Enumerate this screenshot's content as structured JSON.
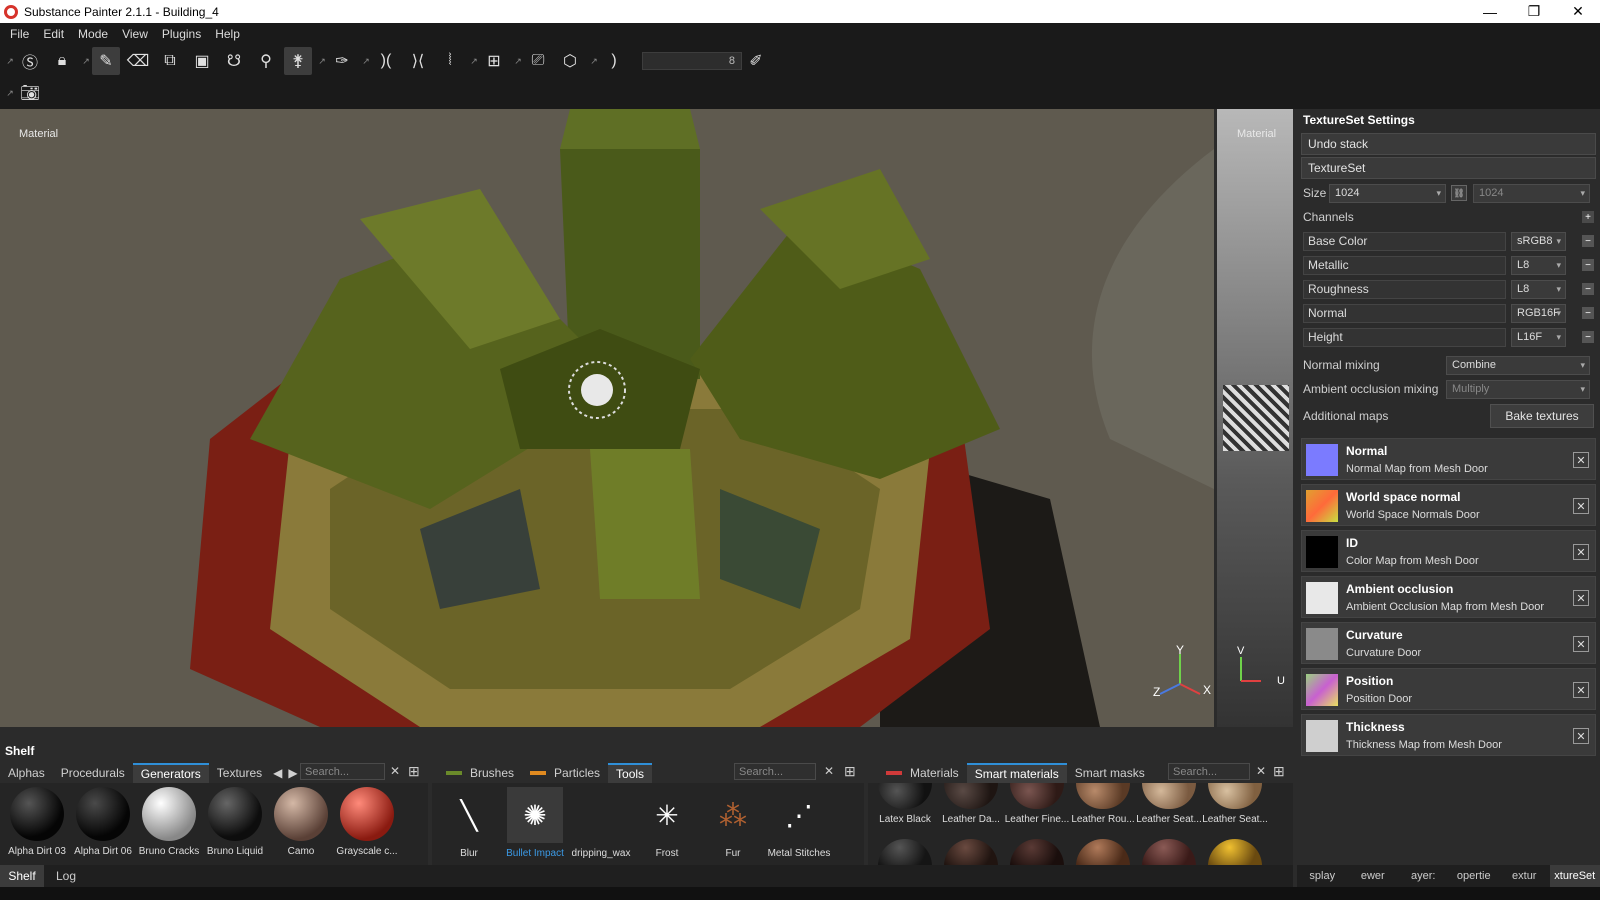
{
  "window": {
    "title": "Substance Painter 2.1.1 - Building_4",
    "minimize": "—",
    "maximize": "❐",
    "close": "✕"
  },
  "menu": [
    "File",
    "Edit",
    "Mode",
    "View",
    "Plugins",
    "Help"
  ],
  "toolbar": {
    "brush_size": "8"
  },
  "viewport": {
    "label": "Material",
    "uv_label": "Material",
    "axis_x": "X",
    "axis_y": "Y",
    "axis_z": "Z",
    "uv_v": "V",
    "uv_u": "U"
  },
  "texture_set": {
    "title": "TextureSet Settings",
    "undo": "Undo stack",
    "textureset": "TextureSet",
    "size_label": "Size",
    "size_value": "1024",
    "size_value2": "1024",
    "channels_label": "Channels",
    "channels": [
      {
        "name": "Base Color",
        "format": "sRGB8"
      },
      {
        "name": "Metallic",
        "format": "L8"
      },
      {
        "name": "Roughness",
        "format": "L8"
      },
      {
        "name": "Normal",
        "format": "RGB16F"
      },
      {
        "name": "Height",
        "format": "L16F"
      }
    ],
    "normal_mixing_label": "Normal mixing",
    "normal_mixing": "Combine",
    "ao_mixing_label": "Ambient occlusion mixing",
    "ao_mixing": "Multiply",
    "additional_label": "Additional maps",
    "bake": "Bake textures",
    "maps": [
      {
        "title": "Normal",
        "sub": "Normal Map from Mesh Door",
        "color": "#7b7bff"
      },
      {
        "title": "World space normal",
        "sub": "World Space Normals Door",
        "color": "#e0a030"
      },
      {
        "title": "ID",
        "sub": "Color Map from Mesh Door",
        "color": "#000000"
      },
      {
        "title": "Ambient occlusion",
        "sub": "Ambient Occlusion Map from Mesh Door",
        "color": "#e8e8e8"
      },
      {
        "title": "Curvature",
        "sub": "Curvature Door",
        "color": "#8a8a8a"
      },
      {
        "title": "Position",
        "sub": "Position Door",
        "color": "#9bd080"
      },
      {
        "title": "Thickness",
        "sub": "Thickness Map from Mesh Door",
        "color": "#cfcfcf"
      }
    ],
    "close_glyph": "✕"
  },
  "right_tabs": [
    "splay",
    "ewer",
    "ayer:",
    "opertie",
    "extur",
    "xtureSet"
  ],
  "shelf": {
    "title": "Shelf",
    "left_tabs": [
      "Alphas",
      "Procedurals",
      "Generators",
      "Textures"
    ],
    "left_search": "Search...",
    "left_items": [
      {
        "label": "Alpha Dirt 03",
        "c1": "#555",
        "c2": "#050505"
      },
      {
        "label": "Alpha Dirt 06",
        "c1": "#4a4a4a",
        "c2": "#050505"
      },
      {
        "label": "Bruno Cracks",
        "c1": "#ffffff",
        "c2": "#888"
      },
      {
        "label": "Bruno Liquid",
        "c1": "#666",
        "c2": "#0d0d0d"
      },
      {
        "label": "Camo",
        "c1": "#d4b8a6",
        "c2": "#5a4036"
      },
      {
        "label": "Grayscale c...",
        "c1": "#ff8a7a",
        "c2": "#8a1a10"
      }
    ],
    "mid_tabs": [
      "Brushes",
      "Particles",
      "Tools"
    ],
    "mid_search": "Search...",
    "mid_items": [
      {
        "label": "Blur",
        "glyph": "╲"
      },
      {
        "label": "Bullet Impact",
        "glyph": "✺"
      },
      {
        "label": "dripping_wax",
        "glyph": ""
      },
      {
        "label": "Frost",
        "glyph": "✳"
      },
      {
        "label": "Fur",
        "glyph": "⁂"
      },
      {
        "label": "Metal Stitches",
        "glyph": "⋰"
      }
    ],
    "right_tabs": [
      "Materials",
      "Smart materials",
      "Smart masks"
    ],
    "right_search": "Search...",
    "right_items": [
      {
        "label": "Latex Black",
        "c1": "#555",
        "c2": "#111"
      },
      {
        "label": "Leather Da...",
        "c1": "#5a4a45",
        "c2": "#1e1512"
      },
      {
        "label": "Leather Fine...",
        "c1": "#7a5550",
        "c2": "#2e1a16"
      },
      {
        "label": "Leather Rou...",
        "c1": "#b88a6a",
        "c2": "#5a3a25"
      },
      {
        "label": "Leather Seat...",
        "c1": "#d4b89a",
        "c2": "#7a5a40"
      },
      {
        "label": "Leather Seat...",
        "c1": "#d8c0a0",
        "c2": "#806040"
      }
    ],
    "close_glyph": "✕"
  },
  "bottom_tabs": [
    "Shelf",
    "Log"
  ]
}
